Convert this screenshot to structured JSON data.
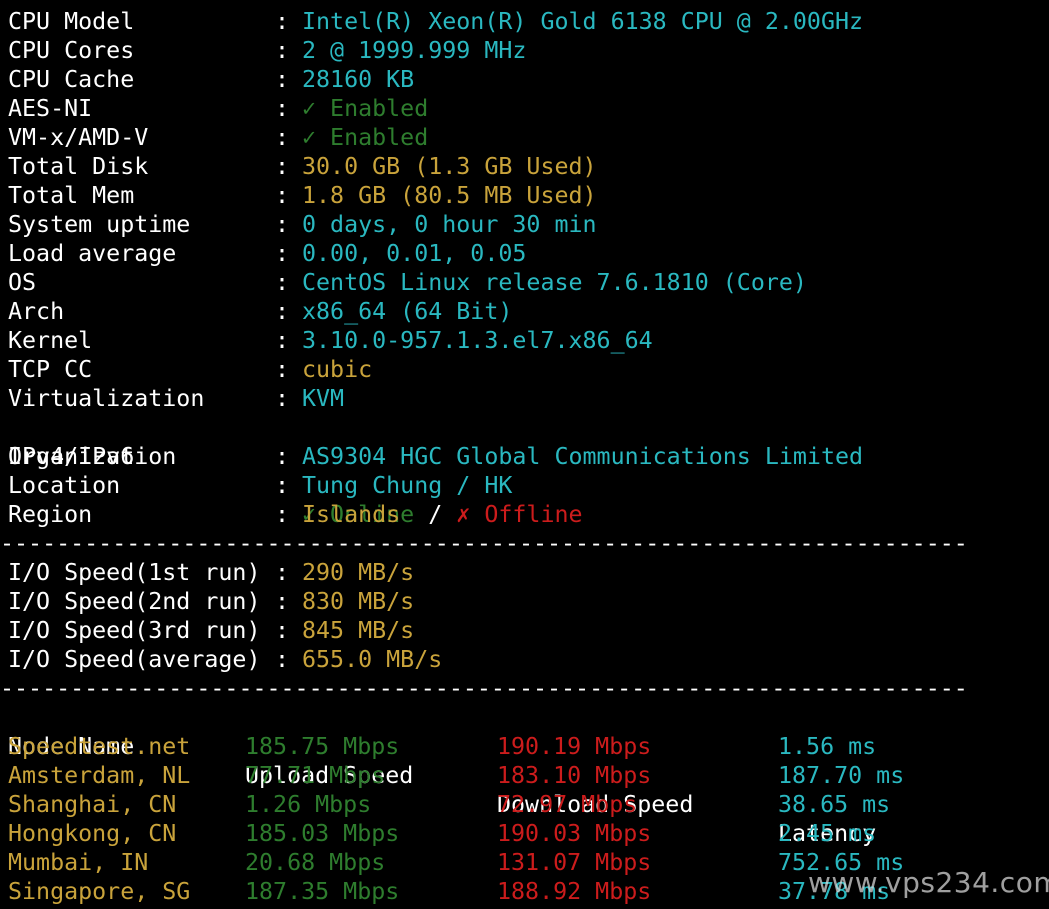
{
  "colors": {
    "background": "#000000",
    "label": "#ffffff",
    "cyan": "#2ab8c0",
    "yellow": "#c9a33b",
    "green": "#2e7d2e",
    "red": "#cc1c1c"
  },
  "sysinfo": [
    {
      "label": "CPU Model",
      "value": "Intel(R) Xeon(R) Gold 6138 CPU @ 2.00GHz",
      "color": "cyan"
    },
    {
      "label": "CPU Cores",
      "value": "2 @ 1999.999 MHz",
      "color": "cyan"
    },
    {
      "label": "CPU Cache",
      "value": "28160 KB",
      "color": "cyan"
    },
    {
      "label": "AES-NI",
      "value": "✓ Enabled",
      "color": "green"
    },
    {
      "label": "VM-x/AMD-V",
      "value": "✓ Enabled",
      "color": "green"
    },
    {
      "label": "Total Disk",
      "value": "30.0 GB (1.3 GB Used)",
      "color": "yellow"
    },
    {
      "label": "Total Mem",
      "value": "1.8 GB (80.5 MB Used)",
      "color": "yellow"
    },
    {
      "label": "System uptime",
      "value": "0 days, 0 hour 30 min",
      "color": "cyan"
    },
    {
      "label": "Load average",
      "value": "0.00, 0.01, 0.05",
      "color": "cyan"
    },
    {
      "label": "OS",
      "value": "CentOS Linux release 7.6.1810 (Core)",
      "color": "cyan"
    },
    {
      "label": "Arch",
      "value": "x86_64 (64 Bit)",
      "color": "cyan"
    },
    {
      "label": "Kernel",
      "value": "3.10.0-957.1.3.el7.x86_64",
      "color": "cyan"
    },
    {
      "label": "TCP CC",
      "value": "cubic",
      "color": "yellow"
    },
    {
      "label": "Virtualization",
      "value": "KVM",
      "color": "cyan"
    }
  ],
  "network": {
    "label": "IPv4/IPv6",
    "online": "✓ Online",
    "slash": " / ",
    "offline": "✗ Offline"
  },
  "location_info": [
    {
      "label": "Organization",
      "value": "AS9304 HGC Global Communications Limited",
      "color": "cyan"
    },
    {
      "label": "Location",
      "value": "Tung Chung / HK",
      "color": "cyan"
    },
    {
      "label": "Region",
      "value": "Islands",
      "color": "yellow"
    }
  ],
  "separator": "----------------------------------------------------------------------",
  "io": [
    {
      "label": "I/O Speed(1st run)",
      "value": "290 MB/s"
    },
    {
      "label": "I/O Speed(2nd run)",
      "value": "830 MB/s"
    },
    {
      "label": "I/O Speed(3rd run)",
      "value": "845 MB/s"
    },
    {
      "label": "I/O Speed(average)",
      "value": "655.0 MB/s"
    }
  ],
  "speedtest": {
    "headers": [
      "Node Name",
      "Upload Speed",
      "Download Speed",
      "Latency"
    ],
    "rows": [
      [
        "Speedtest.net",
        "185.75 Mbps",
        "190.19 Mbps",
        "1.56 ms"
      ],
      [
        "Amsterdam, NL",
        "77.71 Mbps",
        "183.10 Mbps",
        "187.70 ms"
      ],
      [
        "Shanghai, CN",
        "1.26 Mbps",
        "72.97 Mbps",
        "38.65 ms"
      ],
      [
        "Hongkong, CN",
        "185.03 Mbps",
        "190.03 Mbps",
        "2.45 ms"
      ],
      [
        "Mumbai, IN",
        "20.68 Mbps",
        "131.07 Mbps",
        "752.65 ms"
      ],
      [
        "Singapore, SG",
        "187.35 Mbps",
        "188.92 Mbps",
        "37.78 ms"
      ]
    ]
  },
  "watermark": "www.vps234.com"
}
